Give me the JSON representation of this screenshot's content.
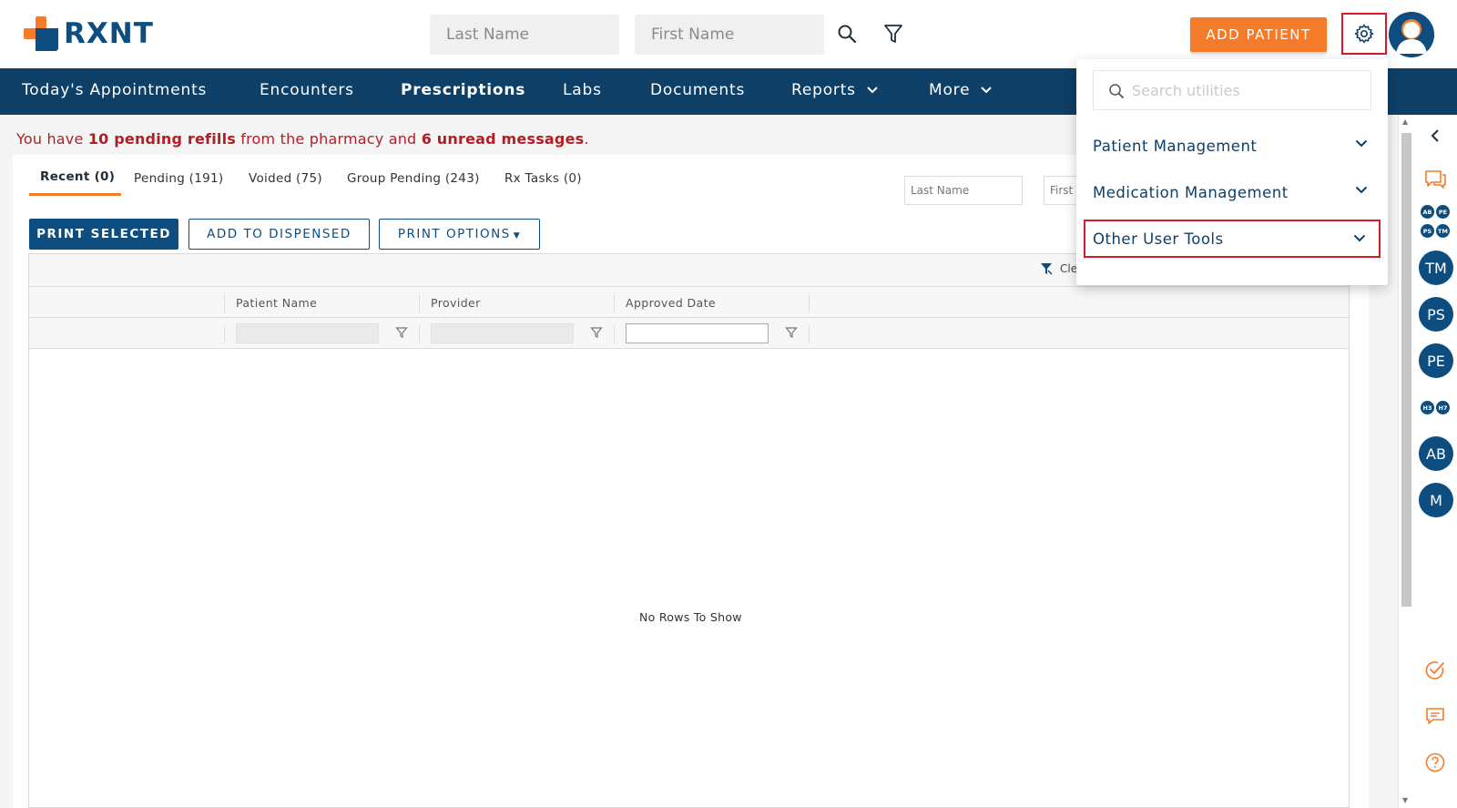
{
  "header": {
    "logo_text": "RXNT",
    "last_name_placeholder": "Last Name",
    "first_name_placeholder": "First Name",
    "add_patient_label": "ADD PATIENT"
  },
  "nav": {
    "items": [
      {
        "label": "Today's Appointments"
      },
      {
        "label": "Encounters"
      },
      {
        "label": "Prescriptions",
        "active": true
      },
      {
        "label": "Labs"
      },
      {
        "label": "Documents"
      },
      {
        "label": "Reports"
      },
      {
        "label": "More"
      }
    ]
  },
  "alert": {
    "prefix": "You have",
    "refills": "10 pending refills",
    "middle": "from the pharmacy and",
    "messages": "6 unread messages",
    "suffix": "."
  },
  "tabs": [
    {
      "label": "Recent (0)",
      "active": true
    },
    {
      "label": "Pending (191)"
    },
    {
      "label": "Voided (75)"
    },
    {
      "label": "Group Pending (243)"
    },
    {
      "label": "Rx Tasks (0)"
    }
  ],
  "filters": {
    "last_name_placeholder": "Last Name",
    "first_name_placeholder": "First N"
  },
  "actions": {
    "print_selected": "PRINT SELECTED",
    "add_to_dispensed": "ADD TO DISPENSED",
    "print_options": "PRINT OPTIONS"
  },
  "grid": {
    "clear_label": "Cle",
    "columns": [
      "Patient Name",
      "Provider",
      "Approved Date"
    ],
    "empty_message": "No Rows To Show"
  },
  "rail": {
    "mini_avatars": [
      "AB",
      "PE",
      "PS",
      "TM"
    ],
    "avatars": [
      "TM",
      "PS",
      "PE"
    ],
    "mini_avatars_2": [
      "H3",
      "H7"
    ],
    "avatars_2": [
      "AB",
      "M"
    ]
  },
  "dropdown": {
    "search_placeholder": "Search utilities",
    "items": [
      {
        "label": "Patient Management"
      },
      {
        "label": "Medication Management"
      },
      {
        "label": "Other User Tools",
        "highlighted": true
      }
    ]
  },
  "colors": {
    "brand_navy": "#0e3f67",
    "brand_blue": "#0e4d7f",
    "brand_orange": "#f47b2a",
    "alert_red": "#b11f24",
    "highlight_red": "#d7192a"
  }
}
